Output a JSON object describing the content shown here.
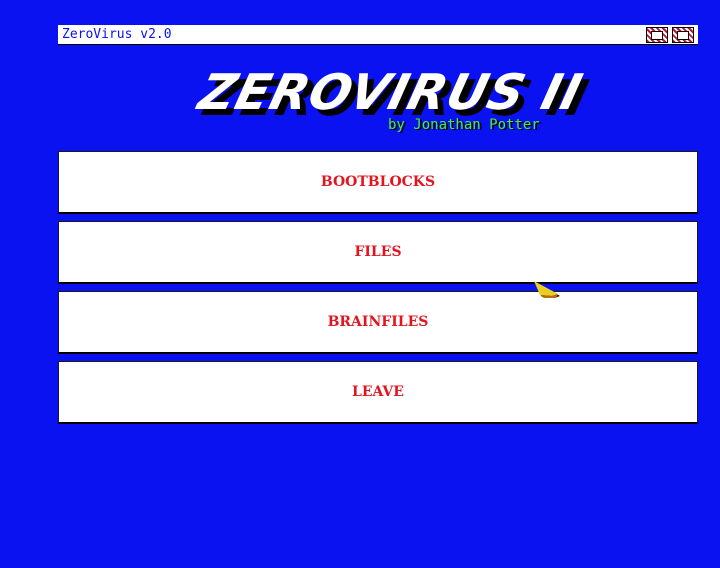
{
  "window": {
    "title": "ZeroVirus v2.0",
    "gadgets": [
      "depth-gadget",
      "zoom-gadget"
    ]
  },
  "logo": {
    "title": "ZEROVIRUS II",
    "byline": "by Jonathan Potter"
  },
  "menu": {
    "items": [
      {
        "label": "BOOTBLOCKS"
      },
      {
        "label": "FILES"
      },
      {
        "label": "BRAINFILES"
      },
      {
        "label": "LEAVE"
      }
    ]
  },
  "colors": {
    "background": "#0a12f2",
    "button_text": "#e4141e",
    "byline": "#3ef03e",
    "titlebar_text": "#0a12f2",
    "pointer": "#e8d020"
  },
  "icons": {
    "pointer": "mouse-pointer-icon"
  }
}
